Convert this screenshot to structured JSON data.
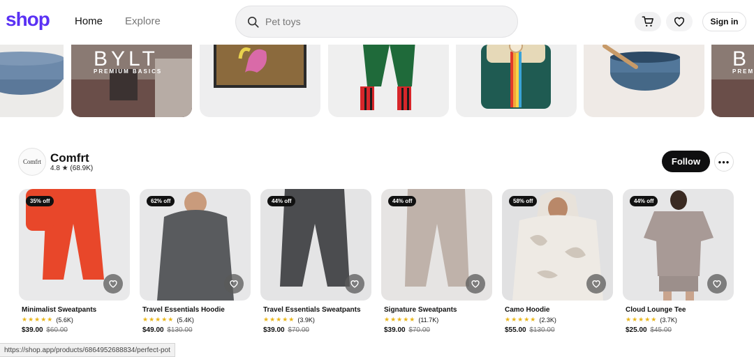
{
  "header": {
    "logo": "shop",
    "nav": [
      {
        "label": "Home",
        "active": true
      },
      {
        "label": "Explore",
        "active": false
      }
    ],
    "search": {
      "placeholder": "Pet toys",
      "value": ""
    },
    "signin_label": "Sign in"
  },
  "carousel": {
    "tiles": [
      {
        "name": "blue-pot-tile",
        "logo_text": ""
      },
      {
        "name": "bylt-tile",
        "logo_text": "BYLT",
        "logo_sub": "PREMIUM BASICS"
      },
      {
        "name": "doormat-tile",
        "logo_text": ""
      },
      {
        "name": "striped-pants-tile",
        "logo_text": ""
      },
      {
        "name": "backpack-tile",
        "logo_text": ""
      },
      {
        "name": "perfect-pot-tile",
        "logo_text": ""
      },
      {
        "name": "bylt-tile-2",
        "logo_text": "B",
        "logo_sub": "PREM"
      }
    ]
  },
  "shop": {
    "name": "Comfrt",
    "avatar_text": "Comfrt",
    "rating": "4.8 ★ (68.9K)",
    "follow_label": "Follow",
    "more_label": "•••"
  },
  "products": [
    {
      "title": "Minimalist Sweatpants",
      "discount": "35% off",
      "reviews": "(5.6K)",
      "price": "$39.00",
      "old_price": "$60.00",
      "color": "#e8472a",
      "bg": "#e9e9ea"
    },
    {
      "title": "Travel Essentials Hoodie",
      "discount": "62% off",
      "reviews": "(5.4K)",
      "price": "$49.00",
      "old_price": "$130.00",
      "color": "#595b5e",
      "bg": "#e7e7e8"
    },
    {
      "title": "Travel Essentials Sweatpants",
      "discount": "44% off",
      "reviews": "(3.9K)",
      "price": "$39.00",
      "old_price": "$70.00",
      "color": "#4b4c4f",
      "bg": "#e4e4e5"
    },
    {
      "title": "Signature Sweatpants",
      "discount": "44% off",
      "reviews": "(11.7K)",
      "price": "$39.00",
      "old_price": "$70.00",
      "color": "#bfb2aa",
      "bg": "#e6e4e3"
    },
    {
      "title": "Camo Hoodie",
      "discount": "58% off",
      "reviews": "(2.3K)",
      "price": "$55.00",
      "old_price": "$130.00",
      "color": "#eeeae4",
      "bg": "#e1e1e2"
    },
    {
      "title": "Cloud Lounge Tee",
      "discount": "44% off",
      "reviews": "(3.7K)",
      "price": "$25.00",
      "old_price": "$45.00",
      "color": "#a89a96",
      "bg": "#e6e6e7"
    }
  ],
  "star_glyphs": "★★★★★",
  "status_url": "https://shop.app/products/6864952688834/perfect-pot",
  "colors": {
    "brand": "#5a31f4",
    "star": "#e8b51a",
    "follow_bg": "#0f0f10"
  }
}
